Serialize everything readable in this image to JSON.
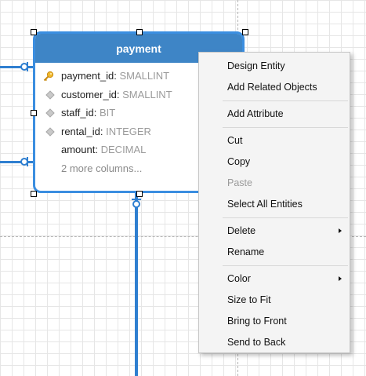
{
  "entity": {
    "title": "payment",
    "columns": [
      {
        "name": "payment_id",
        "type": "SMALLINT",
        "icon": "key-icon"
      },
      {
        "name": "customer_id",
        "type": "SMALLINT",
        "icon": "attribute-diamond-icon"
      },
      {
        "name": "staff_id",
        "type": "BIT",
        "icon": "attribute-diamond-icon"
      },
      {
        "name": "rental_id",
        "type": "INTEGER",
        "icon": "attribute-diamond-icon"
      },
      {
        "name": "amount",
        "type": "DECIMAL",
        "icon": ""
      }
    ],
    "more_columns": "2 more columns...",
    "type_separator": ":"
  },
  "context_menu": {
    "items": [
      {
        "label": "Design Entity"
      },
      {
        "label": "Add Related Objects"
      },
      {
        "label": "Add Attribute"
      },
      {
        "label": "Cut"
      },
      {
        "label": "Copy"
      },
      {
        "label": "Paste",
        "disabled": true
      },
      {
        "label": "Select All Entities"
      },
      {
        "label": "Delete",
        "submenu": true
      },
      {
        "label": "Rename"
      },
      {
        "label": "Color",
        "submenu": true
      },
      {
        "label": "Size to Fit"
      },
      {
        "label": "Bring to Front"
      },
      {
        "label": "Send to Back"
      }
    ]
  },
  "colors": {
    "header": "#3e85c6",
    "border": "#3b8ee0",
    "connector": "#2f7fd0",
    "menu_bg": "#f4f4f4"
  }
}
